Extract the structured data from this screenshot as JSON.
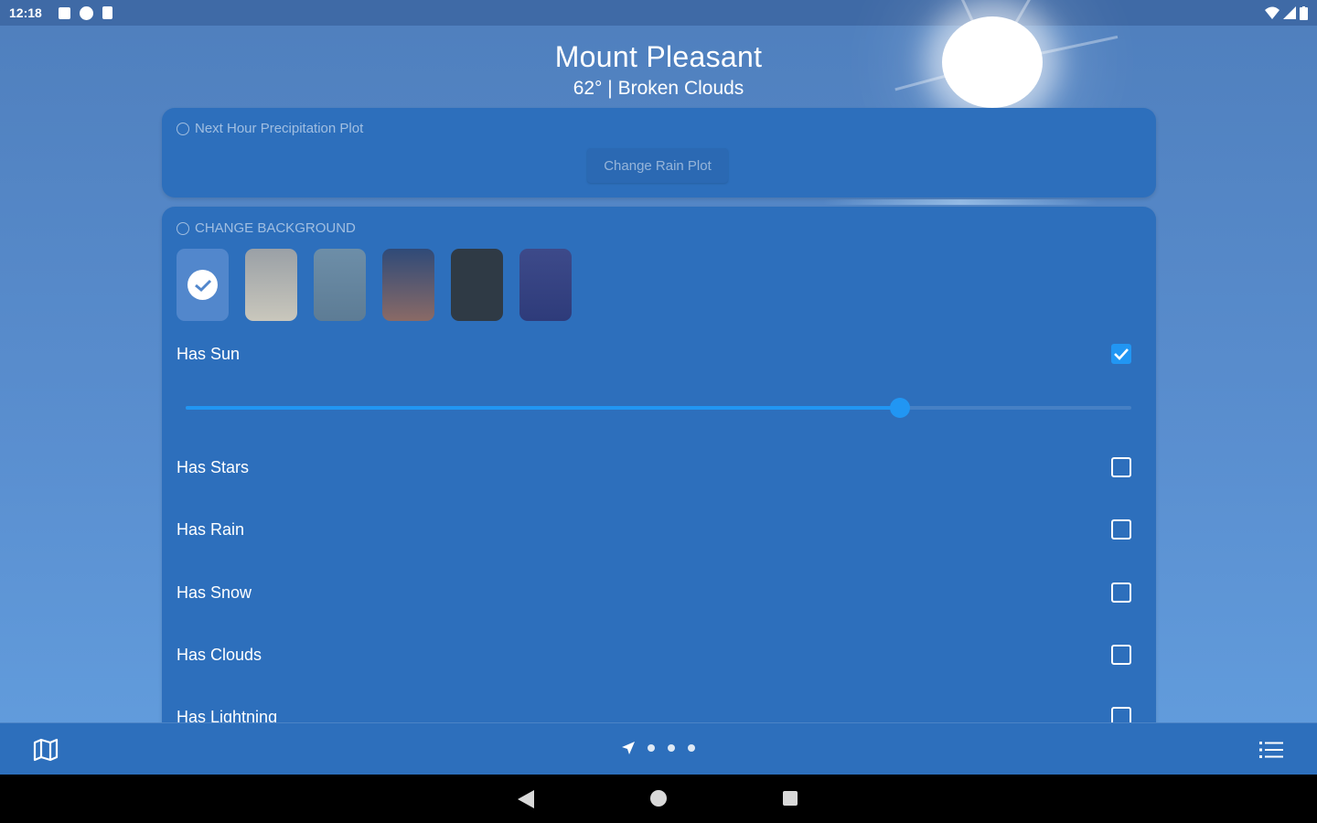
{
  "status_bar": {
    "time": "12:18"
  },
  "header": {
    "city": "Mount Pleasant",
    "condition": "62°  |  Broken Clouds"
  },
  "precip_card": {
    "title": "Next Hour Precipitation Plot",
    "button_label": "Change Rain Plot"
  },
  "background_card": {
    "title": "CHANGE BACKGROUND",
    "swatches": [
      {
        "name": "blue",
        "selected": true
      },
      {
        "name": "gray",
        "selected": false
      },
      {
        "name": "slate",
        "selected": false
      },
      {
        "name": "dusk",
        "selected": false
      },
      {
        "name": "dark",
        "selected": false
      },
      {
        "name": "indigo",
        "selected": false
      }
    ],
    "options": [
      {
        "label": "Has Sun",
        "checked": true
      },
      {
        "label": "Has Stars",
        "checked": false
      },
      {
        "label": "Has Rain",
        "checked": false
      },
      {
        "label": "Has Snow",
        "checked": false
      },
      {
        "label": "Has Clouds",
        "checked": false
      },
      {
        "label": "Has Lightning",
        "checked": false
      }
    ],
    "sun_slider_fraction": 0.755
  },
  "bottom_bar": {
    "pager_dots": 3
  },
  "colors": {
    "accent": "#2196f3",
    "card": "#2d6fbc",
    "sky_top": "#4f7fbd",
    "sky_bottom": "#64a0e0"
  }
}
